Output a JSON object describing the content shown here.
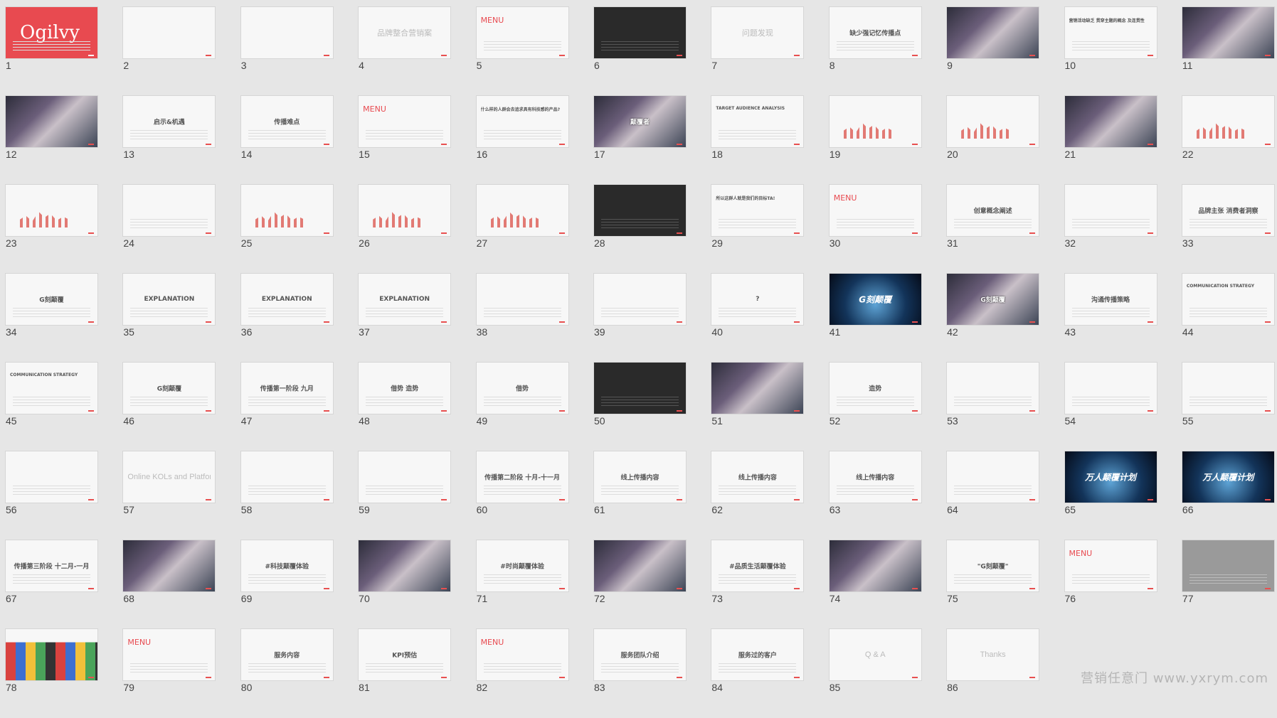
{
  "watermark": "营销任意门 www.yxrym.com",
  "slides": [
    {
      "n": "1",
      "title": "Ogilvy",
      "v": "red"
    },
    {
      "n": "2",
      "title": "",
      "v": "light"
    },
    {
      "n": "3",
      "title": "",
      "v": "light"
    },
    {
      "n": "4",
      "title": "品牌整合营销案",
      "v": "light"
    },
    {
      "n": "5",
      "title": "MENU",
      "v": "menu"
    },
    {
      "n": "6",
      "title": "",
      "v": "dark"
    },
    {
      "n": "7",
      "title": "问题发现",
      "v": "light"
    },
    {
      "n": "8",
      "title": "缺少强记忆传播点",
      "v": "plain"
    },
    {
      "n": "9",
      "title": "",
      "v": "photo"
    },
    {
      "n": "10",
      "title": "营销活动缺乏 贯穿主题的概念 及连贯性",
      "v": "plain"
    },
    {
      "n": "11",
      "title": "",
      "v": "photo"
    },
    {
      "n": "12",
      "title": "",
      "v": "photo"
    },
    {
      "n": "13",
      "title": "启示&机遇",
      "v": "plain"
    },
    {
      "n": "14",
      "title": "传播难点",
      "v": "plain"
    },
    {
      "n": "15",
      "title": "MENU",
      "v": "menu"
    },
    {
      "n": "16",
      "title": "什么样的人群会去追求具有科技感的产品?",
      "v": "plain"
    },
    {
      "n": "17",
      "title": "颠覆者",
      "v": "photo"
    },
    {
      "n": "18",
      "title": "TARGET AUDIENCE ANALYSIS",
      "v": "plain"
    },
    {
      "n": "19",
      "title": "",
      "v": "chart"
    },
    {
      "n": "20",
      "title": "",
      "v": "chart"
    },
    {
      "n": "21",
      "title": "",
      "v": "photo"
    },
    {
      "n": "22",
      "title": "",
      "v": "chart"
    },
    {
      "n": "23",
      "title": "",
      "v": "chart"
    },
    {
      "n": "24",
      "title": "",
      "v": "plain"
    },
    {
      "n": "25",
      "title": "",
      "v": "chart"
    },
    {
      "n": "26",
      "title": "",
      "v": "chart"
    },
    {
      "n": "27",
      "title": "",
      "v": "chart"
    },
    {
      "n": "28",
      "title": "",
      "v": "dark"
    },
    {
      "n": "29",
      "title": "所以这群人就是我们的目标TA!",
      "v": "plain"
    },
    {
      "n": "30",
      "title": "MENU",
      "v": "menu"
    },
    {
      "n": "31",
      "title": "创意概念阐述",
      "v": "plain"
    },
    {
      "n": "32",
      "title": "",
      "v": "plain"
    },
    {
      "n": "33",
      "title": "品牌主张 消费者洞察",
      "v": "plain"
    },
    {
      "n": "34",
      "title": "G刻颠覆",
      "v": "plain"
    },
    {
      "n": "35",
      "title": "EXPLANATION",
      "v": "plain"
    },
    {
      "n": "36",
      "title": "EXPLANATION",
      "v": "plain"
    },
    {
      "n": "37",
      "title": "EXPLANATION",
      "v": "plain"
    },
    {
      "n": "38",
      "title": "",
      "v": "plain"
    },
    {
      "n": "39",
      "title": "",
      "v": "plain"
    },
    {
      "n": "40",
      "title": "?",
      "v": "plain"
    },
    {
      "n": "41",
      "title": "G刻颠覆",
      "v": "blue"
    },
    {
      "n": "42",
      "title": "G刻颠覆",
      "v": "photo"
    },
    {
      "n": "43",
      "title": "沟通传播策略",
      "v": "plain"
    },
    {
      "n": "44",
      "title": "COMMUNICATION STRATEGY",
      "v": "plain"
    },
    {
      "n": "45",
      "title": "COMMUNICATION STRATEGY",
      "v": "plain"
    },
    {
      "n": "46",
      "title": "G刻颠覆",
      "v": "plain"
    },
    {
      "n": "47",
      "title": "传播第一阶段 九月",
      "v": "plain"
    },
    {
      "n": "48",
      "title": "借势 造势",
      "v": "plain"
    },
    {
      "n": "49",
      "title": "借势",
      "v": "plain"
    },
    {
      "n": "50",
      "title": "",
      "v": "dark"
    },
    {
      "n": "51",
      "title": "",
      "v": "photo"
    },
    {
      "n": "52",
      "title": "造势",
      "v": "plain"
    },
    {
      "n": "53",
      "title": "",
      "v": "plain"
    },
    {
      "n": "54",
      "title": "",
      "v": "plain"
    },
    {
      "n": "55",
      "title": "",
      "v": "plain"
    },
    {
      "n": "56",
      "title": "",
      "v": "plain"
    },
    {
      "n": "57",
      "title": "Online KOLs and Platform Introduction",
      "v": "light"
    },
    {
      "n": "58",
      "title": "",
      "v": "plain"
    },
    {
      "n": "59",
      "title": "",
      "v": "plain"
    },
    {
      "n": "60",
      "title": "传播第二阶段 十月-十一月",
      "v": "plain"
    },
    {
      "n": "61",
      "title": "线上传播内容",
      "v": "plain"
    },
    {
      "n": "62",
      "title": "线上传播内容",
      "v": "plain"
    },
    {
      "n": "63",
      "title": "线上传播内容",
      "v": "plain"
    },
    {
      "n": "64",
      "title": "",
      "v": "plain"
    },
    {
      "n": "65",
      "title": "万人颠覆计划",
      "v": "blue"
    },
    {
      "n": "66",
      "title": "万人颠覆计划",
      "v": "blue"
    },
    {
      "n": "67",
      "title": "传播第三阶段 十二月-一月",
      "v": "plain"
    },
    {
      "n": "68",
      "title": "",
      "v": "photo"
    },
    {
      "n": "69",
      "title": "#科技颠覆体验",
      "v": "plain"
    },
    {
      "n": "70",
      "title": "",
      "v": "photo"
    },
    {
      "n": "71",
      "title": "#时尚颠覆体验",
      "v": "plain"
    },
    {
      "n": "72",
      "title": "",
      "v": "photo"
    },
    {
      "n": "73",
      "title": "#品质生活颠覆体验",
      "v": "plain"
    },
    {
      "n": "74",
      "title": "",
      "v": "photo"
    },
    {
      "n": "75",
      "title": "\"G刻颠覆\"",
      "v": "plain"
    },
    {
      "n": "76",
      "title": "MENU",
      "v": "menu"
    },
    {
      "n": "77",
      "title": "",
      "v": "grey"
    },
    {
      "n": "78",
      "title": "",
      "v": "color"
    },
    {
      "n": "79",
      "title": "MENU",
      "v": "menu"
    },
    {
      "n": "80",
      "title": "服务内容",
      "v": "plain"
    },
    {
      "n": "81",
      "title": "KPI预估",
      "v": "plain"
    },
    {
      "n": "82",
      "title": "MENU",
      "v": "menu"
    },
    {
      "n": "83",
      "title": "服务团队介绍",
      "v": "plain"
    },
    {
      "n": "84",
      "title": "服务过的客户",
      "v": "plain"
    },
    {
      "n": "85",
      "title": "Q & A",
      "v": "light"
    },
    {
      "n": "86",
      "title": "Thanks",
      "v": "light"
    }
  ]
}
